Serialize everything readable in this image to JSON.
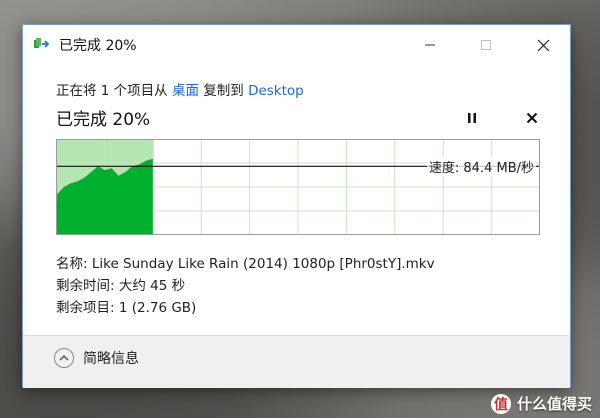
{
  "window": {
    "title": "已完成 20%",
    "app_icon": "copy-files-icon"
  },
  "copy": {
    "prefix": "正在将 1 个项目从 ",
    "source": "桌面",
    "middle": " 复制到 ",
    "destination": "Desktop"
  },
  "status": {
    "label": "已完成 20%",
    "progress": 0.2
  },
  "graph": {
    "speed_label": "速度: 84.4 MB/秒",
    "fill_color": "#00b02e",
    "progress_fill_color": "#b3e6b0",
    "speed_samples": [
      0.42,
      0.5,
      0.54,
      0.56,
      0.6,
      0.66,
      0.72,
      0.68,
      0.7,
      0.62,
      0.66,
      0.72,
      0.74,
      0.78,
      0.8
    ],
    "current_speed_level": 0.72
  },
  "details": {
    "name": "名称: Like Sunday Like Rain (2014) 1080p [Phr0stY].mkv",
    "time_remaining": "剩余时间: 大约 45 秒",
    "items_remaining": "剩余项目: 1 (2.76 GB)"
  },
  "footer": {
    "toggle_label": "简略信息"
  },
  "watermark": {
    "logo_text": "值",
    "text": "什么值得买"
  }
}
